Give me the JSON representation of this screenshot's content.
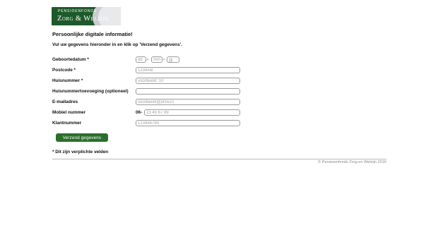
{
  "logo": {
    "line1": "PENSIOENFONDS",
    "line2": "Zorg & Welzijn",
    "colors": {
      "background": "#1d5a2a",
      "swoosh": "#c9ccd0"
    }
  },
  "heading": "Persoonlijke digitale informatie!",
  "intro": "Vul uw gegevens hieronder in en klik op 'Verzend gegevens'.",
  "form": {
    "geboortedatum": {
      "label": "Geboortedatum *",
      "day_placeholder": "dd",
      "month_placeholder": "mm",
      "year_placeholder": "jjjj",
      "separator": "-"
    },
    "postcode": {
      "label": "Postcode *",
      "placeholder": "1234AB"
    },
    "huisnummer": {
      "label": "Huisnummer *",
      "placeholder": "voorbeeld: 10"
    },
    "toevoeging": {
      "label": "Huisnummertoevoeging (optioneel)",
      "placeholder": ""
    },
    "email": {
      "label": "E-mailadres",
      "placeholder": "voorbeeld@pfzw.nl"
    },
    "mobiel": {
      "label": "Mobiel nummer",
      "prefix": "06-",
      "placeholder": "23 45 67 89"
    },
    "klantnummer": {
      "label": "Klantnummer",
      "placeholder": "123456789"
    }
  },
  "submit_label": "Verzend gegevens",
  "required_note": "* Dit zijn verplichte velden",
  "footer": "© Pensioenfonds Zorg en Welzijn 2016",
  "colors": {
    "button": "#2b6f2b",
    "divider": "#b9b9b9",
    "footer_text": "#8a8a8a"
  }
}
